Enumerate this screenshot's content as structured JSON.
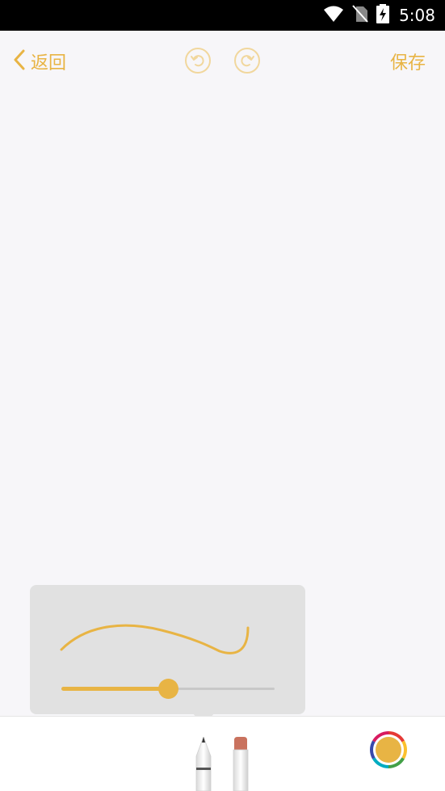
{
  "status_bar": {
    "time": "5:08",
    "icons": [
      "wifi-icon",
      "no-sim-icon",
      "battery-charging-icon"
    ]
  },
  "nav": {
    "back_label": "返回",
    "back_icon": "chevron-left-icon",
    "undo_icon": "undo-icon",
    "redo_icon": "redo-icon",
    "save_label": "保存"
  },
  "stroke_settings": {
    "stroke_width_fraction": 0.5
  },
  "tools": {
    "items": [
      "pencil-icon",
      "eraser-icon"
    ],
    "selected": "pencil-icon"
  },
  "colors": {
    "accent": "#e8b444",
    "current_color": "#e8b444",
    "popover_bg": "#e1e1e1",
    "canvas_bg": "#f7f6f9"
  }
}
